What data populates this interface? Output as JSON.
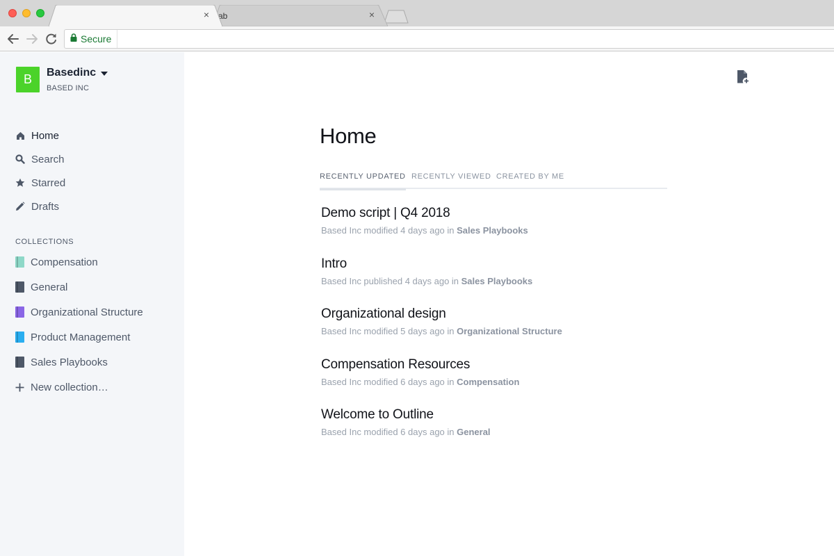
{
  "browser": {
    "tabs": [
      {
        "title": "",
        "close": "×"
      },
      {
        "title": "ab",
        "close": "×"
      }
    ],
    "secure_label": "Secure"
  },
  "team": {
    "logo_letter": "B",
    "name": "Basedinc",
    "subtitle": "BASED INC",
    "logo_color": "#4bd32a"
  },
  "nav": [
    {
      "label": "Home",
      "icon": "home-icon"
    },
    {
      "label": "Search",
      "icon": "search-icon"
    },
    {
      "label": "Starred",
      "icon": "star-icon"
    },
    {
      "label": "Drafts",
      "icon": "pencil-icon"
    }
  ],
  "collections_heading": "COLLECTIONS",
  "collections": [
    {
      "label": "Compensation",
      "color": "#8ed8c8"
    },
    {
      "label": "General",
      "color": "#4e5868"
    },
    {
      "label": "Organizational Structure",
      "color": "#8a66e6"
    },
    {
      "label": "Product Management",
      "color": "#2aaef0"
    },
    {
      "label": "Sales Playbooks",
      "color": "#4e5868"
    }
  ],
  "new_collection": "New collection…",
  "main": {
    "title": "Home",
    "tabs": [
      "RECENTLY UPDATED",
      "RECENTLY VIEWED",
      "CREATED BY ME"
    ],
    "documents": [
      {
        "title": "Demo script | Q4 2018",
        "meta": "Based Inc modified 4 days ago in ",
        "collection": "Sales Playbooks"
      },
      {
        "title": "Intro",
        "meta": "Based Inc published 4 days ago in ",
        "collection": "Sales Playbooks"
      },
      {
        "title": "Organizational design",
        "meta": "Based Inc modified 5 days ago in ",
        "collection": "Organizational Structure"
      },
      {
        "title": "Compensation Resources",
        "meta": "Based Inc modified 6 days ago in ",
        "collection": "Compensation"
      },
      {
        "title": "Welcome to Outline",
        "meta": "Based Inc modified 6 days ago in ",
        "collection": "General"
      }
    ]
  }
}
